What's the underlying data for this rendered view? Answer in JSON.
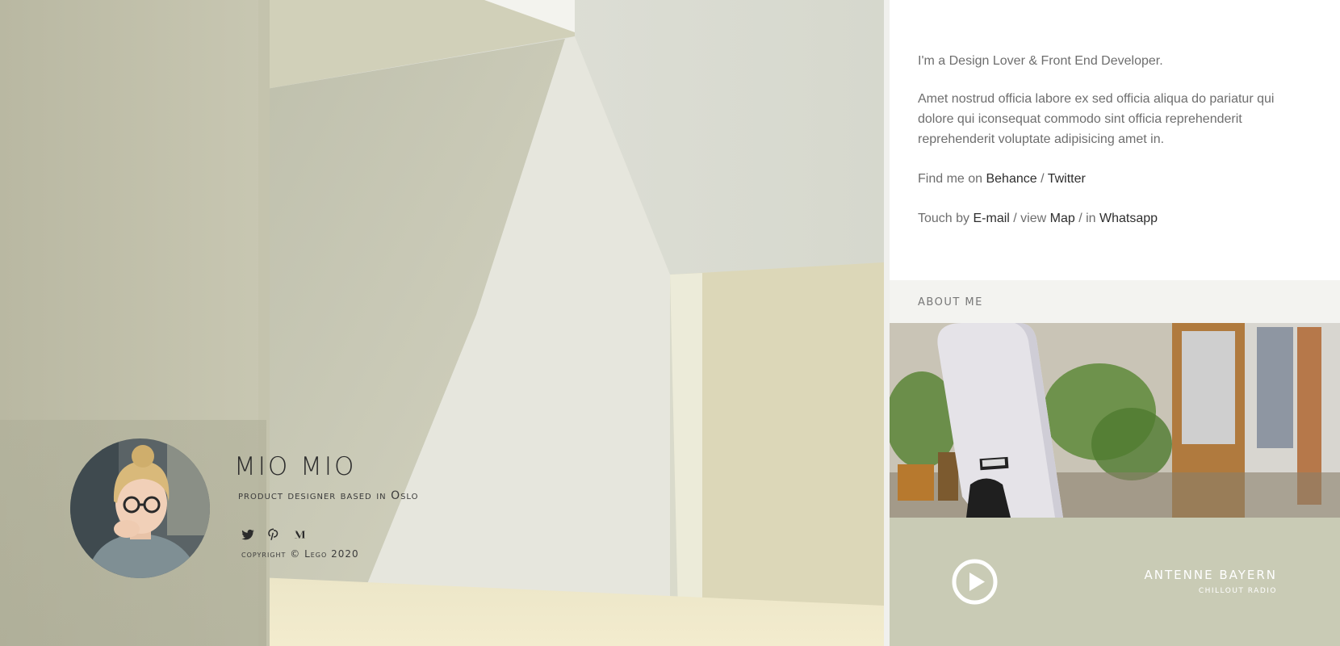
{
  "hero": {
    "name": "MIO MIO",
    "tagline": "product designer based in Oslo",
    "copyright": "copyright © Lego 2020",
    "socials": [
      {
        "icon": "twitter-icon"
      },
      {
        "icon": "pinterest-icon"
      },
      {
        "icon": "medium-icon"
      }
    ]
  },
  "intro": {
    "headline": "I'm a Design Lover & Front End Developer.",
    "body": "Amet nostrud officia labore ex sed officia aliqua do pariatur qui dolore qui iconsequat commodo sint officia reprehenderit reprehenderit voluptate adipisicing amet in.",
    "find_prefix": "Find me on ",
    "behance": "Behance",
    "sep1": " / ",
    "twitter": "Twitter",
    "touch_prefix": "Touch by ",
    "email": "E-mail",
    "view_text": " / view ",
    "map": "Map",
    "in_text": " / in ",
    "whatsapp": "Whatsapp"
  },
  "about": {
    "title": "About me"
  },
  "player": {
    "station_name": "Antenne Bayern",
    "station_sub": "Chillout radio"
  },
  "colors": {
    "player_bg": "#c9cbb5",
    "link": "#2e2e2e",
    "body_text": "#6e6e6e"
  }
}
